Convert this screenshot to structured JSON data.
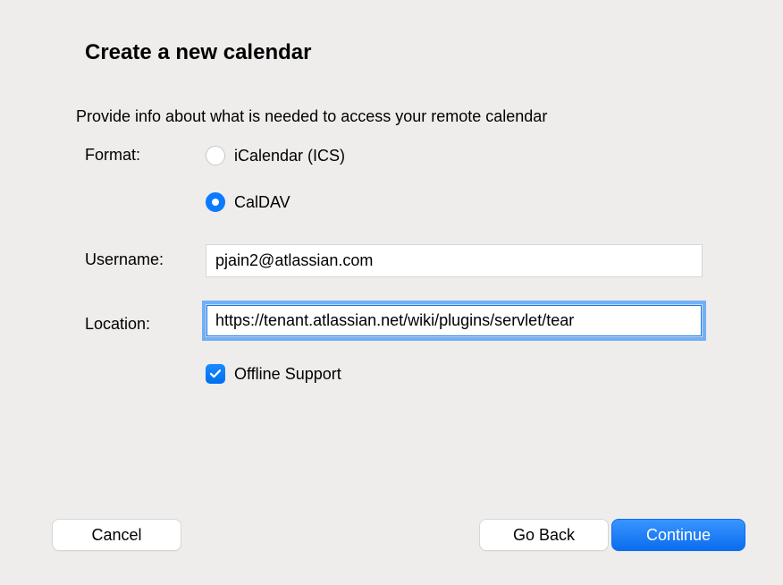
{
  "dialog": {
    "title": "Create a new calendar",
    "subtitle": "Provide info about what is needed to access your remote calendar"
  },
  "fields": {
    "format_label": "Format:",
    "username_label": "Username:",
    "location_label": "Location:"
  },
  "format_options": {
    "ics": {
      "label": "iCalendar (ICS)",
      "selected": false
    },
    "caldav": {
      "label": "CalDAV",
      "selected": true
    }
  },
  "username": {
    "value": "pjain2@atlassian.com"
  },
  "location": {
    "value": "https://tenant.atlassian.net/wiki/plugins/servlet/tear"
  },
  "offline_support": {
    "label": "Offline Support",
    "checked": true
  },
  "buttons": {
    "cancel": "Cancel",
    "goback": "Go Back",
    "continue": "Continue"
  }
}
